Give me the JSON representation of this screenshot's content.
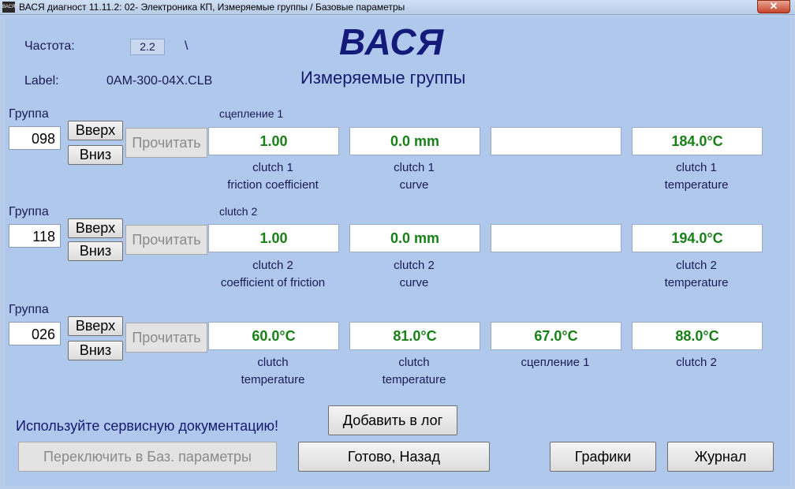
{
  "window": {
    "title": "ВАСЯ диагност 11.11.2: 02- Электроника КП,  Измеряемые группы / Базовые параметры",
    "icon_text": "ВАСЯ",
    "close_symbol": "✕"
  },
  "header": {
    "freq_label": "Частота:",
    "freq_value": "2.2",
    "freq_indicator": "\\",
    "label_caption": "Label:",
    "label_value": "0AM-300-04X.CLB",
    "logo": "ВАСЯ",
    "subtitle": "Измеряемые группы"
  },
  "groups": [
    {
      "label": "Группа",
      "number": "098",
      "up": "Вверх",
      "down": "Вниз",
      "read": "Прочитать",
      "title": "сцепление 1",
      "values": [
        "1.00",
        "0.0 mm",
        "",
        "184.0°C"
      ],
      "captions": [
        "clutch 1\nfriction coefficient",
        "clutch 1\ncurve",
        "",
        "clutch 1\ntemperature"
      ]
    },
    {
      "label": "Группа",
      "number": "118",
      "up": "Вверх",
      "down": "Вниз",
      "read": "Прочитать",
      "title": "clutch 2",
      "values": [
        "1.00",
        "0.0 mm",
        "",
        "194.0°C"
      ],
      "captions": [
        "clutch 2\ncoefficient of friction",
        "clutch 2\ncurve",
        "",
        "clutch 2\ntemperature"
      ]
    },
    {
      "label": "Группа",
      "number": "026",
      "up": "Вверх",
      "down": "Вниз",
      "read": "Прочитать",
      "title": "",
      "values": [
        "60.0°C",
        "81.0°C",
        "67.0°C",
        "88.0°C"
      ],
      "captions": [
        "clutch\ntemperature",
        "clutch\ntemperature",
        "сцепление 1",
        "clutch 2"
      ]
    }
  ],
  "footer": {
    "notice": "Используйте сервисную документацию!",
    "add_log": "Добавить в лог",
    "switch_basic": "Переключить в Баз. параметры",
    "done_back": "Готово, Назад",
    "graphs": "Графики",
    "journal": "Журнал"
  },
  "colors": {
    "background": "#b1c8ed",
    "value_text": "#178017",
    "label_text": "#1a1a55"
  }
}
